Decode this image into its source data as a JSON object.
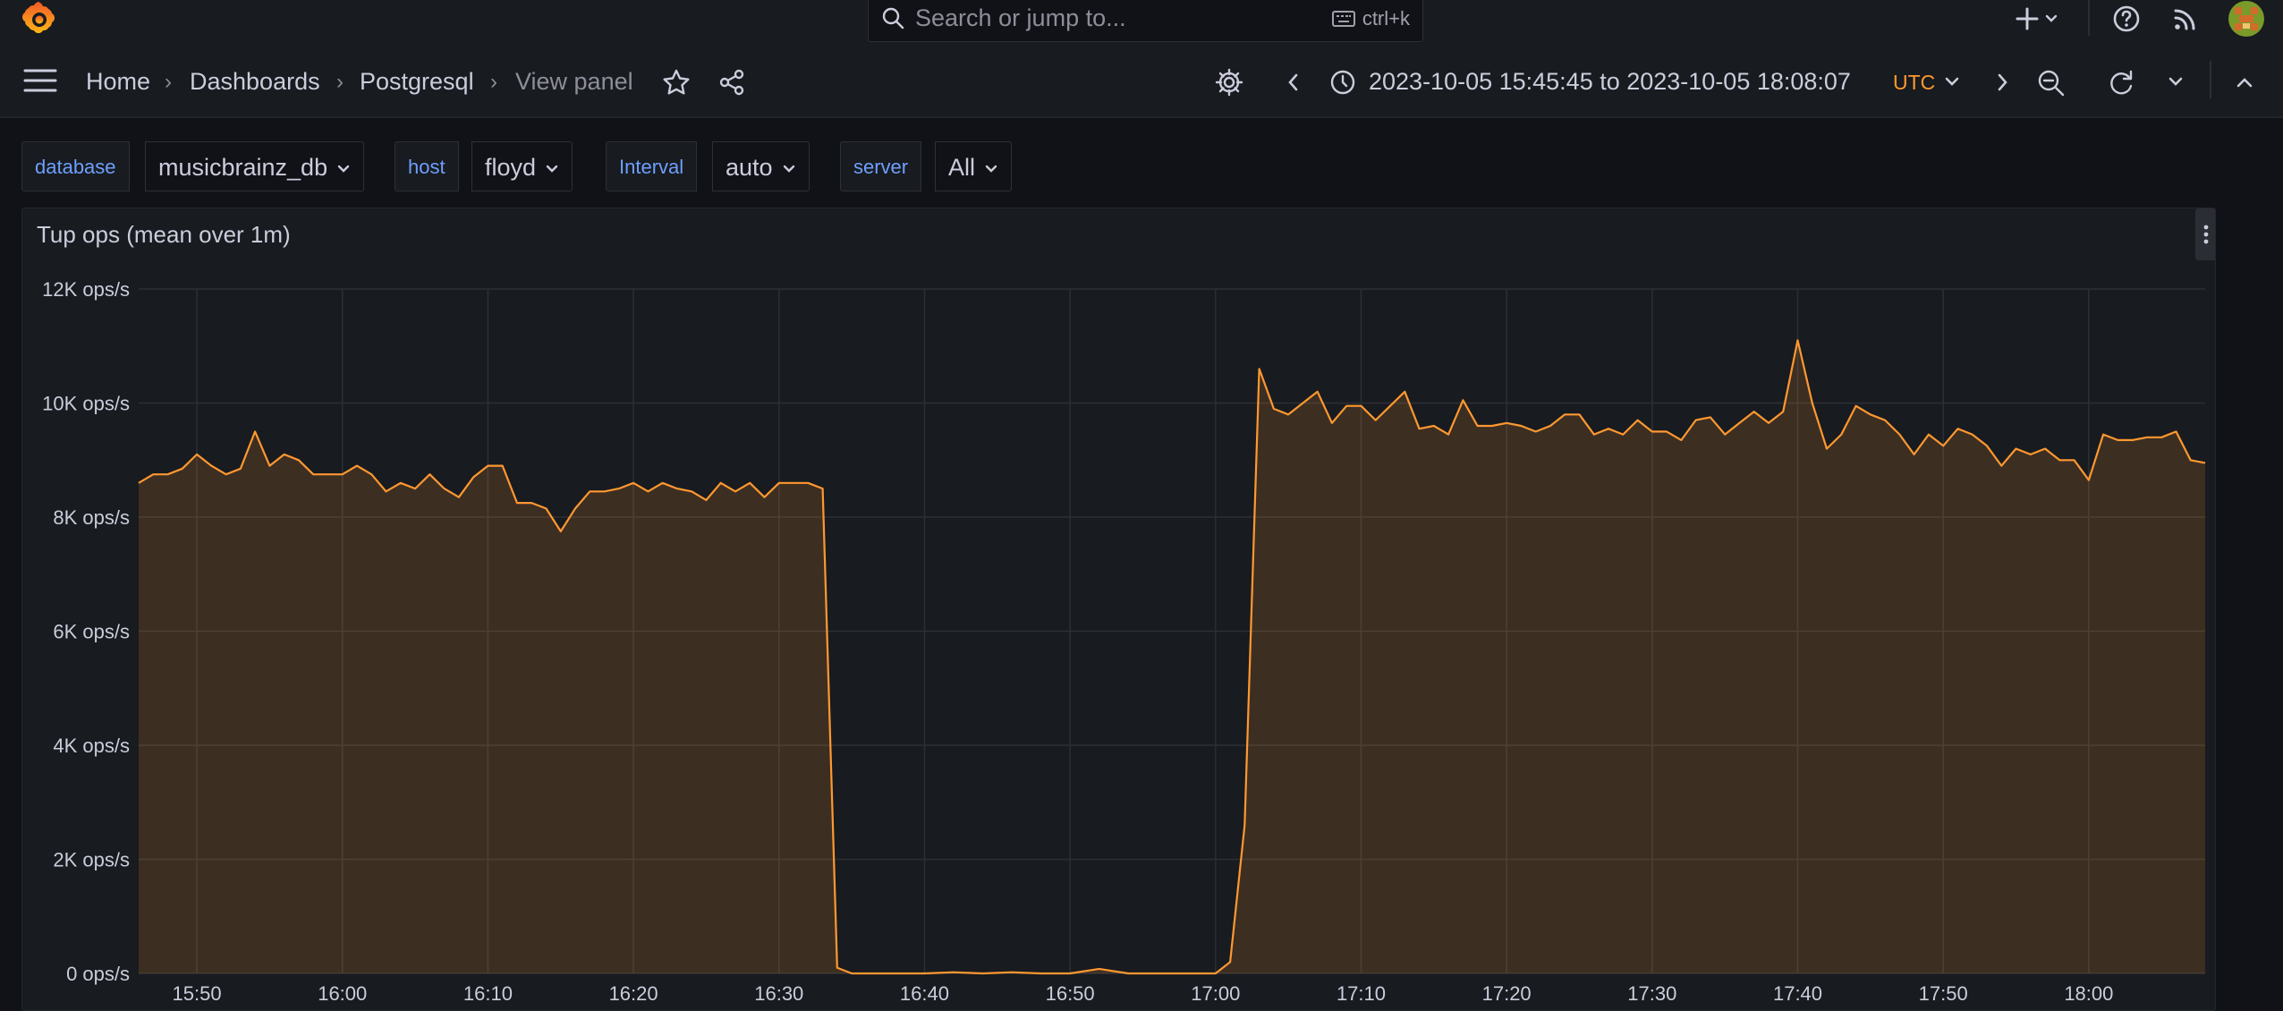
{
  "app": {
    "search_placeholder": "Search or jump to...",
    "search_shortcut": "ctrl+k"
  },
  "breadcrumbs": [
    "Home",
    "Dashboards",
    "Postgresql",
    "View panel"
  ],
  "time": {
    "range": "2023-10-05 15:45:45 to 2023-10-05 18:08:07",
    "timezone": "UTC"
  },
  "variables": [
    {
      "label": "database",
      "value": "musicbrainz_db"
    },
    {
      "label": "host",
      "value": "floyd"
    },
    {
      "label": "Interval",
      "value": "auto"
    },
    {
      "label": "server",
      "value": "All"
    }
  ],
  "colors": {
    "series": "#ff9830",
    "accent": "#6e9fff"
  },
  "panel": {
    "title": "Tup ops (mean over 1m)"
  },
  "chart_data": {
    "type": "area",
    "title": "Tup ops (mean over 1m)",
    "ylim": [
      0,
      12000
    ],
    "yticks": [
      0,
      2000,
      4000,
      6000,
      8000,
      10000,
      12000
    ],
    "ytick_labels": [
      "0 ops/s",
      "2K ops/s",
      "4K ops/s",
      "6K ops/s",
      "8K ops/s",
      "10K ops/s",
      "12K ops/s"
    ],
    "xlim": [
      "15:46",
      "18:08"
    ],
    "xticks": [
      "15:50",
      "16:00",
      "16:10",
      "16:20",
      "16:30",
      "16:40",
      "16:50",
      "17:00",
      "17:10",
      "17:20",
      "17:30",
      "17:40",
      "17:50",
      "18:00"
    ],
    "grid": true,
    "series": [
      {
        "x": [
          "15:46",
          "15:47",
          "15:48",
          "15:49",
          "15:50",
          "15:51",
          "15:52",
          "15:53",
          "15:54",
          "15:55",
          "15:56",
          "15:57",
          "15:58",
          "15:59",
          "16:00",
          "16:01",
          "16:02",
          "16:03",
          "16:04",
          "16:05",
          "16:06",
          "16:07",
          "16:08",
          "16:09",
          "16:10",
          "16:11",
          "16:12",
          "16:13",
          "16:14",
          "16:15",
          "16:16",
          "16:17",
          "16:18",
          "16:19",
          "16:20",
          "16:21",
          "16:22",
          "16:23",
          "16:24",
          "16:25",
          "16:26",
          "16:27",
          "16:28",
          "16:29",
          "16:30",
          "16:31",
          "16:32",
          "16:33",
          "16:34",
          "16:35",
          "16:36",
          "16:38",
          "16:40",
          "16:42",
          "16:44",
          "16:46",
          "16:48",
          "16:50",
          "16:52",
          "16:54",
          "16:56",
          "16:58",
          "17:00",
          "17:01",
          "17:02",
          "17:03",
          "17:04",
          "17:05",
          "17:06",
          "17:07",
          "17:08",
          "17:09",
          "17:10",
          "17:11",
          "17:12",
          "17:13",
          "17:14",
          "17:15",
          "17:16",
          "17:17",
          "17:18",
          "17:19",
          "17:20",
          "17:21",
          "17:22",
          "17:23",
          "17:24",
          "17:25",
          "17:26",
          "17:27",
          "17:28",
          "17:29",
          "17:30",
          "17:31",
          "17:32",
          "17:33",
          "17:34",
          "17:35",
          "17:36",
          "17:37",
          "17:38",
          "17:39",
          "17:40",
          "17:41",
          "17:42",
          "17:43",
          "17:44",
          "17:45",
          "17:46",
          "17:47",
          "17:48",
          "17:49",
          "17:50",
          "17:51",
          "17:52",
          "17:53",
          "17:54",
          "17:55",
          "17:56",
          "17:57",
          "17:58",
          "17:59",
          "18:00",
          "18:01",
          "18:02",
          "18:03",
          "18:04",
          "18:05",
          "18:06",
          "18:07",
          "18:08"
        ],
        "y": [
          8600,
          8750,
          8750,
          8850,
          9100,
          8900,
          8750,
          8850,
          9500,
          8900,
          9100,
          9000,
          8750,
          8750,
          8750,
          8900,
          8750,
          8450,
          8600,
          8500,
          8750,
          8500,
          8350,
          8700,
          8900,
          8900,
          8250,
          8250,
          8150,
          7750,
          8150,
          8450,
          8450,
          8500,
          8600,
          8450,
          8600,
          8500,
          8450,
          8300,
          8600,
          8450,
          8600,
          8350,
          8600,
          8600,
          8600,
          8500,
          100,
          0,
          0,
          0,
          0,
          20,
          0,
          20,
          0,
          0,
          80,
          0,
          0,
          0,
          0,
          200,
          2600,
          10600,
          9900,
          9800,
          10000,
          10200,
          9650,
          9950,
          9950,
          9700,
          9950,
          10200,
          9550,
          9600,
          9450,
          10050,
          9600,
          9600,
          9650,
          9600,
          9500,
          9600,
          9800,
          9800,
          9450,
          9550,
          9450,
          9700,
          9500,
          9500,
          9350,
          9700,
          9750,
          9450,
          9650,
          9850,
          9650,
          9850,
          11100,
          10000,
          9200,
          9450,
          9950,
          9800,
          9700,
          9450,
          9100,
          9450,
          9250,
          9550,
          9450,
          9250,
          8900,
          9200,
          9100,
          9200,
          9000,
          9000,
          8650,
          9450,
          9350,
          9350,
          9400,
          9400,
          9500,
          9000,
          8950
        ]
      }
    ]
  }
}
